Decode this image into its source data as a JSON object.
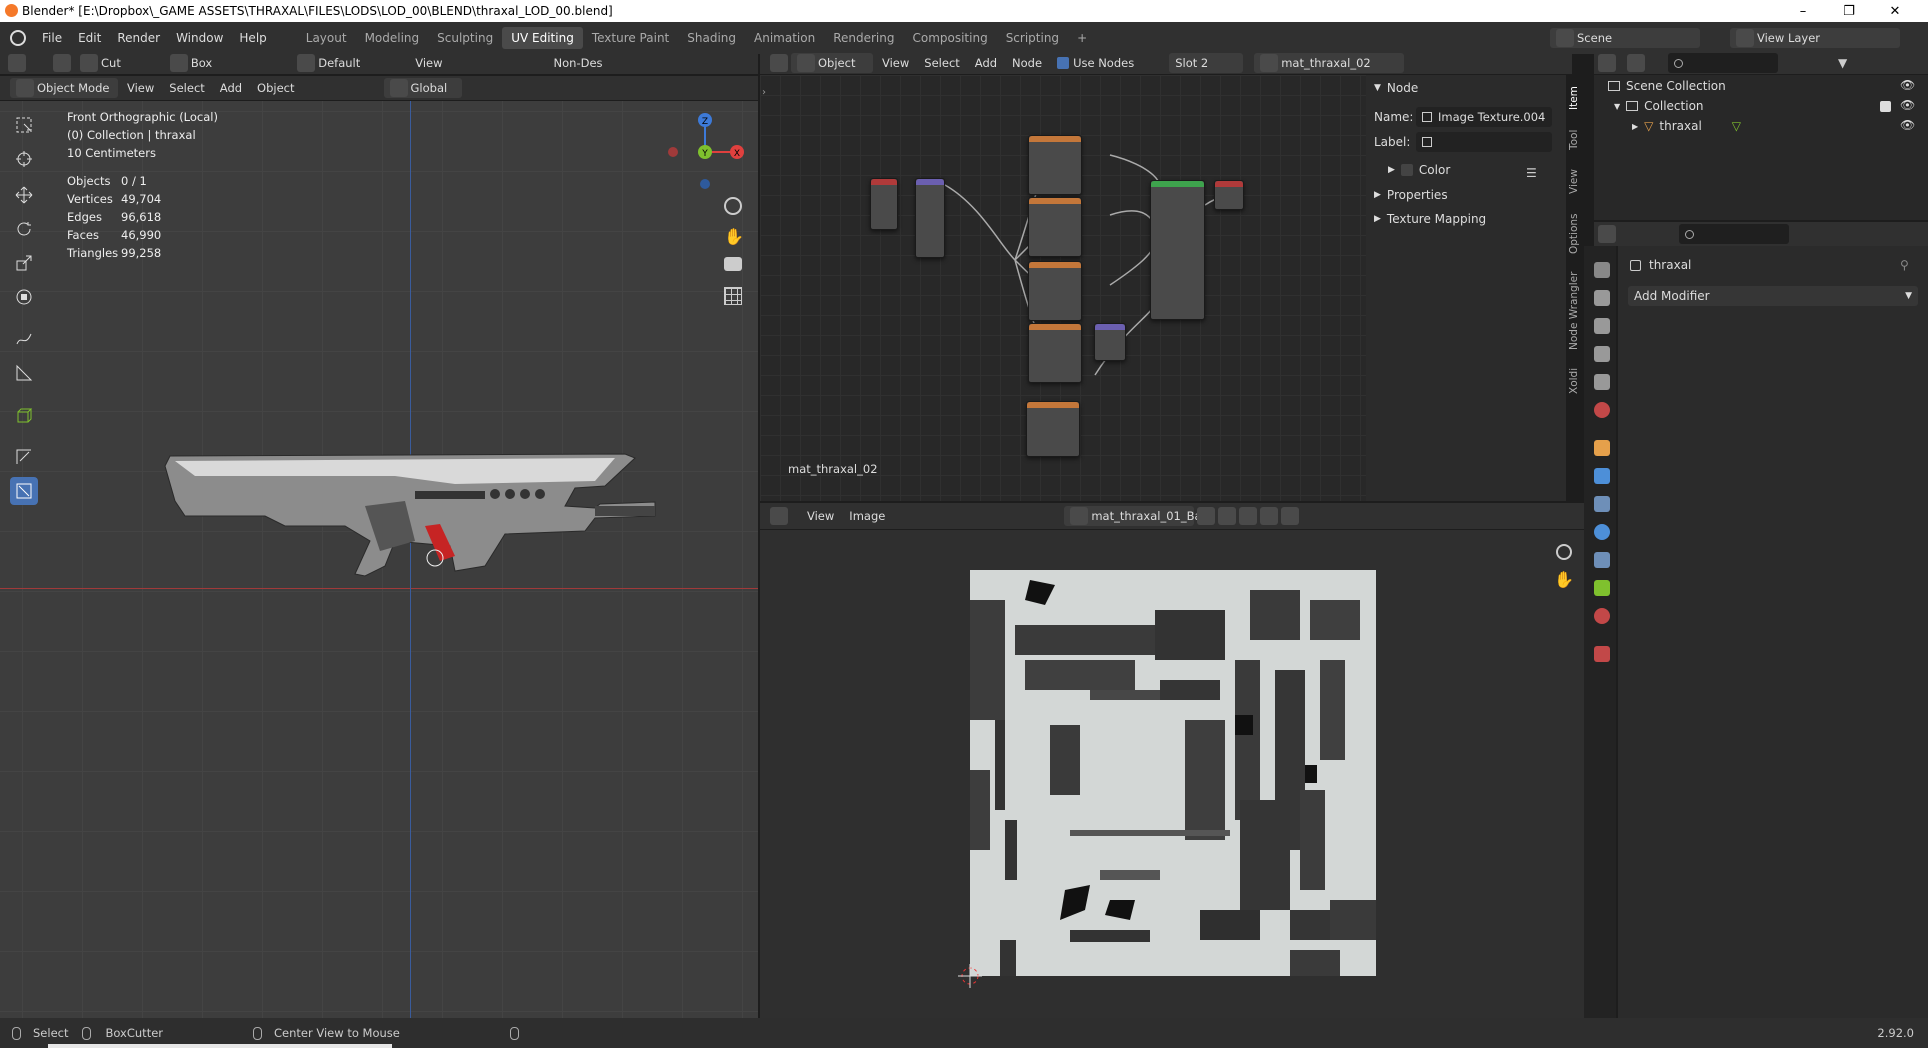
{
  "window": {
    "title": "Blender* [E:\\Dropbox\\_GAME ASSETS\\THRAXAL\\FILES\\LODS\\LOD_00\\BLEND\\thraxal_LOD_00.blend]"
  },
  "menu": [
    "File",
    "Edit",
    "Render",
    "Window",
    "Help"
  ],
  "workspaces": [
    "Layout",
    "Modeling",
    "Sculpting",
    "UV Editing",
    "Texture Paint",
    "Shading",
    "Animation",
    "Rendering",
    "Compositing",
    "Scripting"
  ],
  "active_workspace": "UV Editing",
  "scene": {
    "label": "Scene",
    "view_layer": "View Layer"
  },
  "tool_header": {
    "cut": "Cut",
    "box": "Box",
    "pivot": "Default",
    "view": "View",
    "non_des": "Non-Des"
  },
  "viewport": {
    "mode": "Object Mode",
    "menus": [
      "View",
      "Select",
      "Add",
      "Object"
    ],
    "transform": "Global",
    "overlay_lines": [
      "Front Orthographic (Local)",
      "(0) Collection | thraxal",
      "10 Centimeters"
    ],
    "stats": [
      {
        "k": "Objects",
        "v": "0 / 1"
      },
      {
        "k": "Vertices",
        "v": "49,704"
      },
      {
        "k": "Edges",
        "v": "96,618"
      },
      {
        "k": "Faces",
        "v": "46,990"
      },
      {
        "k": "Triangles",
        "v": "99,258"
      }
    ],
    "gizmo": {
      "z": "Z",
      "y": "Y",
      "x": "X"
    }
  },
  "node_editor": {
    "type": "Object",
    "menus": [
      "View",
      "Select",
      "Add",
      "Node"
    ],
    "use_nodes": "Use Nodes",
    "slot": "Slot 2",
    "material": "mat_thraxal_02",
    "footer_label": "mat_thraxal_02",
    "panel": {
      "section": "Node",
      "name_label": "Name:",
      "name_value": "Image Texture.004",
      "label_label": "Label:",
      "label_value": "",
      "color": "Color",
      "properties": "Properties",
      "texture_mapping": "Texture Mapping"
    },
    "side_tabs": [
      "Item",
      "Tool",
      "View",
      "Options",
      "Node Wrangler",
      "Xoldi"
    ]
  },
  "image_editor": {
    "menus": [
      "View",
      "Image"
    ],
    "image_name": "mat_thraxal_01_Ba..."
  },
  "outliner": {
    "scene_collection": "Scene Collection",
    "collection": "Collection",
    "object": "thraxal"
  },
  "properties": {
    "object": "thraxal",
    "add_modifier": "Add Modifier"
  },
  "status_bar": {
    "select": "Select",
    "boxcutter": "BoxCutter",
    "center": "Center View to Mouse",
    "version": "2.92.0"
  },
  "colors": {
    "accent": "#4772b3",
    "x_axis": "#e0403e",
    "y_axis": "#7fc12e",
    "z_axis": "#3d7ad8"
  }
}
